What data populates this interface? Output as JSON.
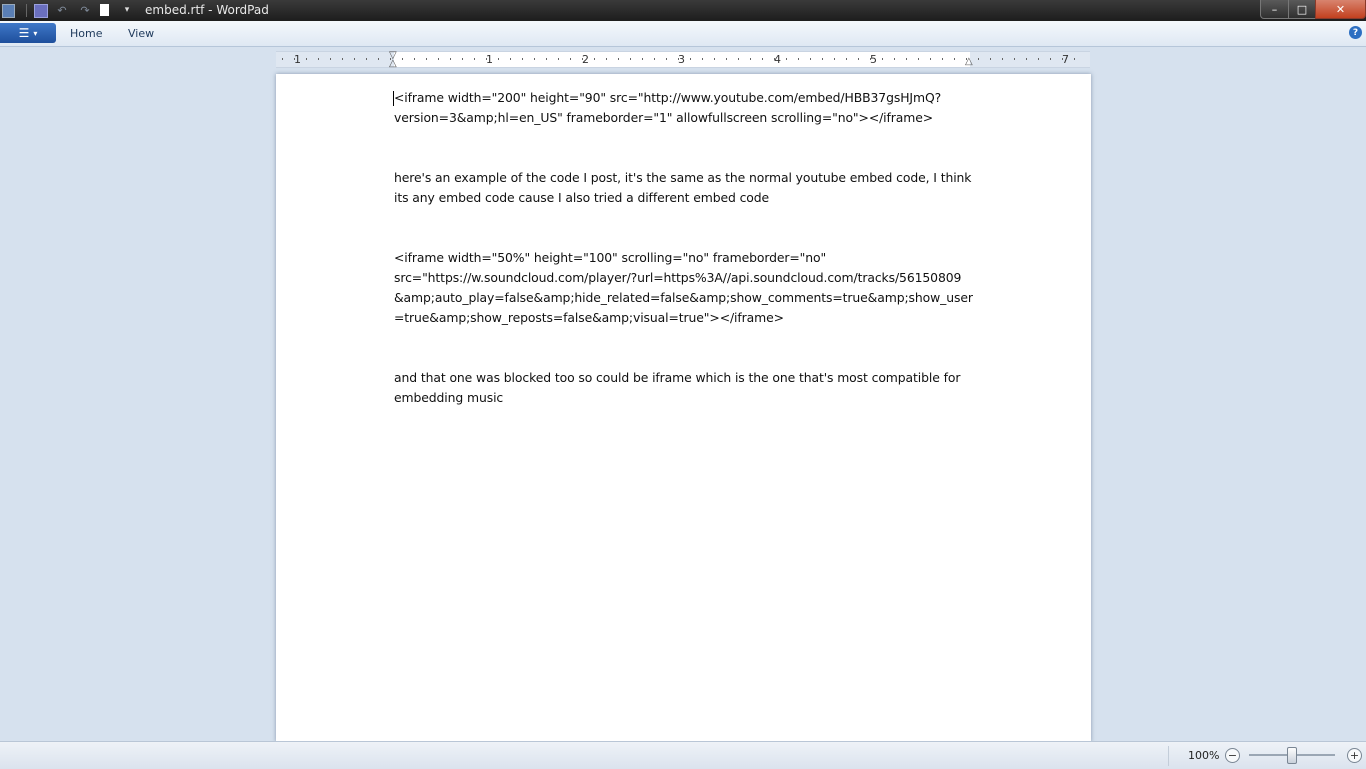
{
  "window": {
    "title": "embed.rtf - WordPad",
    "controls": {
      "minimize": "–",
      "maximize": "□",
      "close": "✕"
    }
  },
  "quick_access": {
    "icons": [
      "app-icon",
      "save-icon",
      "undo-icon",
      "redo-icon",
      "new-document-icon",
      "customize-icon"
    ],
    "undo_glyph": "↶",
    "redo_glyph": "↷",
    "more_glyph": "▾"
  },
  "ribbon": {
    "menu_glyph": "☰",
    "menu_chevron": "▾",
    "tabs": [
      {
        "label": "Home"
      },
      {
        "label": "View"
      }
    ],
    "help_glyph": "?"
  },
  "ruler": {
    "labels": [
      "1",
      "1",
      "2",
      "3",
      "4",
      "5",
      "7"
    ]
  },
  "document": {
    "paragraphs": [
      "<iframe width=\"200\" height=\"90\" src=\"http://www.youtube.com/embed/HBB37gsHJmQ?\nversion=3&amp;hl=en_US\" frameborder=\"1\" allowfullscreen scrolling=\"no\"></iframe>",
      "",
      "",
      "here's an example of the code I post, it's the same as the normal youtube embed code, I think\nits any embed code cause I also tried a different embed code",
      "",
      "",
      "<iframe width=\"50%\" height=\"100\" scrolling=\"no\" frameborder=\"no\"\nsrc=\"https://w.soundcloud.com/player/?url=https%3A//api.soundcloud.com/tracks/56150809\n&amp;auto_play=false&amp;hide_related=false&amp;show_comments=true&amp;show_user\n=true&amp;show_reposts=false&amp;visual=true\"></iframe>",
      "",
      "",
      "and that one was blocked too so could be iframe which is the one that's most compatible for\nembedding music"
    ]
  },
  "statusbar": {
    "zoom_label": "100%",
    "zoom_out_glyph": "−",
    "zoom_in_glyph": "+",
    "zoom_level": 1.0
  }
}
